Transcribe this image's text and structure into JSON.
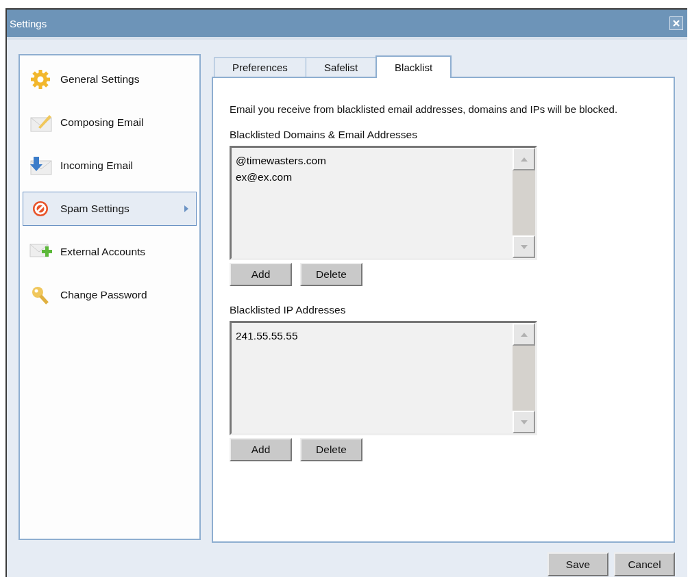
{
  "window": {
    "title": "Settings"
  },
  "sidebar": {
    "items": [
      {
        "label": "General Settings",
        "selected": false
      },
      {
        "label": "Composing Email",
        "selected": false
      },
      {
        "label": "Incoming Email",
        "selected": false
      },
      {
        "label": "Spam Settings",
        "selected": true
      },
      {
        "label": "External Accounts",
        "selected": false
      },
      {
        "label": "Change Password",
        "selected": false
      }
    ]
  },
  "tabs": [
    {
      "label": "Preferences",
      "selected": false
    },
    {
      "label": "Safelist",
      "selected": false
    },
    {
      "label": "Blacklist",
      "selected": true
    }
  ],
  "description": "Email you receive from blacklisted email addresses, domains and IPs will be blocked.",
  "lists": [
    {
      "label": "Blacklisted Domains & Email Addresses",
      "entries": [
        "@timewasters.com",
        "ex@ex.com"
      ],
      "buttons": [
        "Add",
        "Delete"
      ]
    },
    {
      "label": "Blacklisted IP Addresses",
      "entries": [
        "241.55.55.55"
      ],
      "buttons": [
        "Add",
        "Delete"
      ]
    }
  ],
  "footer_buttons": [
    "Save",
    "Cancel"
  ]
}
